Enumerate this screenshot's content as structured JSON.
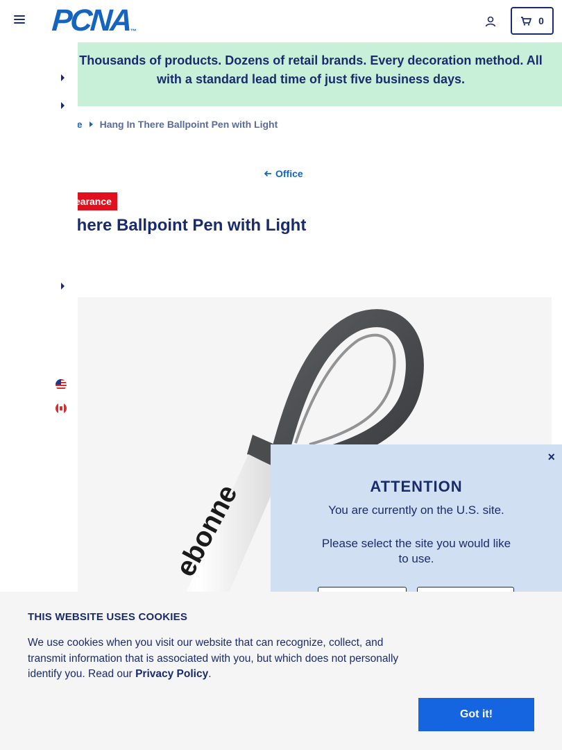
{
  "header": {
    "logo_text": "PCNA",
    "logo_tm": "™",
    "cart_count": "0"
  },
  "banner": {
    "text": "Thousands of products. Dozens of retail brands. Every decoration method. All with a standard lead time of just five business days."
  },
  "breadcrumb": {
    "parent": "ce",
    "current": "Hang In There Ballpoint Pen with Light"
  },
  "back_link": "Office",
  "product": {
    "badge": "earance",
    "title": "There Ballpoint Pen with Light",
    "imprint_text": "ebonne"
  },
  "attention_modal": {
    "close": "×",
    "title": "ATTENTION",
    "message": "You are currently on the U.S. site.",
    "select": "Please select the site you would like to use."
  },
  "cookie": {
    "title": "THIS WEBSITE USES COOKIES",
    "body_pre": "We use cookies when you visit our website that can recognize, collect, and transmit information that is associated with you, but which does not personally identify you. Read our ",
    "link": "Privacy Policy",
    "body_post": ".",
    "button": "Got it!"
  },
  "colors": {
    "navy": "#1a2b6d",
    "brand_blue": "#1565c0",
    "banner_green": "#c8f0d8",
    "clearance_red": "#e0101f",
    "modal_blue": "#d0dff2",
    "button_blue": "#1565e0"
  },
  "icons": [
    "hamburger-icon",
    "user-icon",
    "cart-icon",
    "back-arrow-icon",
    "chevron-right-icon",
    "us-flag-icon",
    "canada-flag-icon",
    "close-icon"
  ]
}
